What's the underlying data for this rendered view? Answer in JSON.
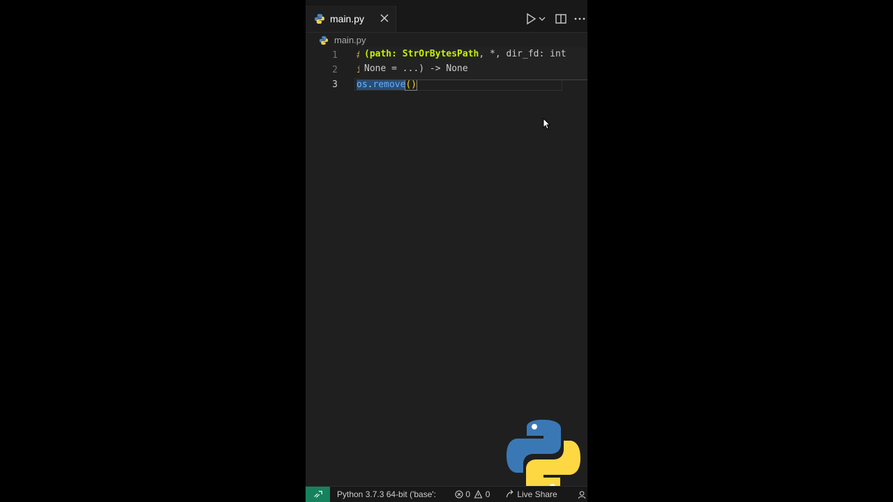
{
  "tab": {
    "label": "main.py"
  },
  "breadcrumb": {
    "label": "main.py"
  },
  "toolbar": {
    "run_icon": "play-icon",
    "split_icon": "split-editor-icon",
    "more_icon": "ellipsis-icon"
  },
  "editor": {
    "lines": [
      {
        "num": "1",
        "text": "#"
      },
      {
        "num": "2",
        "text": "i"
      },
      {
        "num": "3",
        "os": "os",
        "dot": ".",
        "fn": "remove",
        "paren": "()"
      }
    ]
  },
  "signature": {
    "line1_active": "(path: StrOrBytesPath",
    "line1_rest": ", *, dir_fd: int",
    "line2": "None = ...) -> None"
  },
  "status": {
    "python": "Python 3.7.3 64-bit ('base':",
    "errors": "0",
    "warnings": "0",
    "live_share": "Live Share"
  },
  "colors": {
    "remote_accent": "#16825d",
    "editor_bg": "#1f1f1f",
    "signature_active": "#c5f000"
  }
}
